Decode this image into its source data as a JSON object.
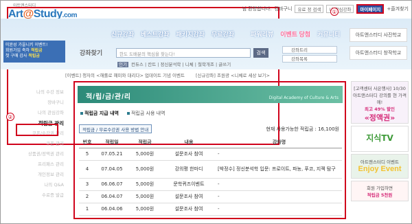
{
  "header": {
    "logo_sub": "아트앤스터디",
    "logo_main": "Art",
    "logo_main2": "Study",
    "logo_main3": ".com",
    "greeting": "님 환영합니다.",
    "cart": "강바구니",
    "search_select": "유료 정 검색",
    "interest_select": "내 관심강좌",
    "mypage": "마이페이지",
    "bookmark": "+즐겨찾기"
  },
  "nav": {
    "items": [
      "신규강좌",
      "베스트강좌",
      "패키지강좌",
      "무료강좌",
      "파워리뷰",
      "이벤트 당첨",
      "커뮤니티"
    ]
  },
  "promo": {
    "line1": "미완성 가을니키 이벤트!",
    "line2a": "회원가입 축하 ",
    "line2b": "적립금",
    "line3a": "첫 구매 감사 ",
    "line3b": "적립금"
  },
  "search": {
    "label": "강좌찾기",
    "placeholder": "한도 도배분의 핵심을 찾는다!",
    "button": "검색",
    "tag_on": "인기",
    "tags": "컨듀스 | 칸트 | 정신분석학 | 니체 | 철학개조 | 글쓰기"
  },
  "side_buttons": [
    "강좌트리",
    "강좌목록"
  ],
  "right_boxes": [
    "아트앤스터디 사진학교",
    "아트앤스터디 창작학교"
  ],
  "ticker": [
    "[이벤트] 청자의 <해롤로 혜미와 대리다> 업데이트 기념 이벤트",
    "[신규강좌] 조원광 <니체로 세상 보기>"
  ],
  "sidebar": {
    "items": [
      "나의 수강 정보",
      "장바구니",
      "나의 관심강좌",
      "적립금 관리",
      "쿠폰/수강권 관리",
      "쿠폰 관리",
      "상품권/정액권 관리",
      "프리패스 관리",
      "개인정보 관리",
      "나의 Q&A",
      "수료증 발급"
    ],
    "active_index": 3
  },
  "annotations": {
    "one": "①",
    "two": "②"
  },
  "main": {
    "title": "적/립/금/관/리",
    "title_en": "Digital Academy of Culture & Arts",
    "tabs": [
      "적립금 지급 내역",
      "적립금 사용 내역"
    ],
    "guide": "적립금 / 무료수강권 사용 방법 안내",
    "available": "현재 사용가능한 적립금 : 16,100원",
    "columns": [
      "번호",
      "적립일",
      "적립금",
      "내용",
      "강좌명"
    ],
    "rows": [
      [
        "5",
        "07.05.21",
        "5,000원",
        "설문조사 참여",
        "-"
      ],
      [
        "4",
        "07.04.05",
        "5,000원",
        "강의평 한마디",
        "[박정수] 정신분석학 입문: 프로이트, 파농, 푸코, 지젝 탐구"
      ],
      [
        "3",
        "06.06.07",
        "5,000원",
        "문학퀴즈이벤트",
        "-"
      ],
      [
        "2",
        "06.04.07",
        "5,000원",
        "설문조사 참여",
        "-"
      ],
      [
        "1",
        "06.04.06",
        "5,000원",
        "설문조사 참여",
        "-"
      ]
    ]
  },
  "ads": {
    "a1": "[고객센터 사은행사] 10/30",
    "a2": "아트앤스터디 강의를 현 가격에!",
    "a3": "최고 49% 할인",
    "a4": "«정액권»",
    "a5": "지식TV",
    "a6": "Enjoy Event",
    "a7": "아트앤스터디 이벤트",
    "a8": "회원 가입하면",
    "a9": "적립금 5천원"
  }
}
